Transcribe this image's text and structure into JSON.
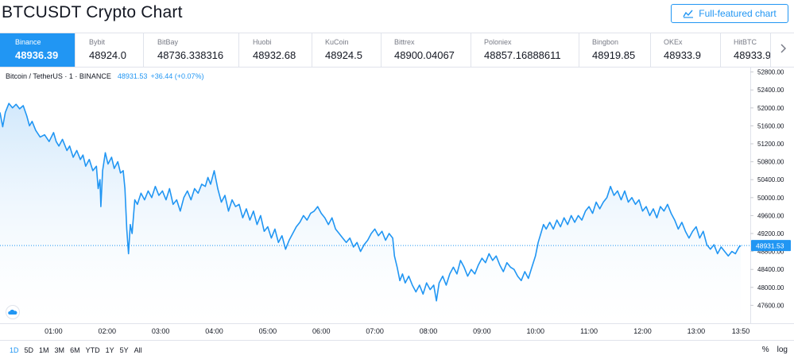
{
  "header": {
    "title": "BTCUSDT Crypto Chart",
    "full_chart_label": "Full-featured chart"
  },
  "exchanges": [
    {
      "name": "Binance",
      "price": "48936.39",
      "active": true
    },
    {
      "name": "Bybit",
      "price": "48924.0"
    },
    {
      "name": "BitBay",
      "price": "48736.338316"
    },
    {
      "name": "Huobi",
      "price": "48932.68"
    },
    {
      "name": "KuCoin",
      "price": "48924.5"
    },
    {
      "name": "Bittrex",
      "price": "48900.04067"
    },
    {
      "name": "Poloniex",
      "price": "48857.16888611"
    },
    {
      "name": "Bingbon",
      "price": "48919.85"
    },
    {
      "name": "OKEx",
      "price": "48933.9"
    },
    {
      "name": "HitBTC",
      "price": "48933.9"
    }
  ],
  "legend": {
    "symbol": "Bitcoin / TetherUS · 1 · BINANCE",
    "last": "48931.53",
    "change": "+36.44 (+0.07%)"
  },
  "ranges": {
    "items": [
      "1D",
      "5D",
      "1M",
      "3M",
      "6M",
      "YTD",
      "1Y",
      "5Y",
      "All"
    ],
    "active": "1D",
    "percent_label": "%",
    "log_label": "log"
  },
  "colors": {
    "line": "#2196f3",
    "area_top": "#cde6fb",
    "area_bottom": "#ffffff",
    "active_tab": "#2196f3",
    "grid": "#f0f3fa"
  },
  "chart_data": {
    "type": "area",
    "title": "",
    "xlabel": "",
    "ylabel": "",
    "x_ticks": [
      "01:00",
      "02:00",
      "03:00",
      "04:00",
      "05:00",
      "06:00",
      "07:00",
      "08:00",
      "09:00",
      "10:00",
      "11:00",
      "12:00",
      "13:00",
      "13:50"
    ],
    "y_ticks": [
      47600,
      48000,
      48400,
      48800,
      49200,
      49600,
      50000,
      50400,
      50800,
      51200,
      51600,
      52000,
      52400,
      52800
    ],
    "ylim": [
      47200,
      52900
    ],
    "last_price": 48931.53,
    "series": [
      {
        "points": [
          [
            "00:00",
            51900
          ],
          [
            "00:03",
            51580
          ],
          [
            "00:06",
            51900
          ],
          [
            "00:10",
            52100
          ],
          [
            "00:14",
            52000
          ],
          [
            "00:18",
            52080
          ],
          [
            "00:22",
            51980
          ],
          [
            "00:26",
            52050
          ],
          [
            "00:30",
            51820
          ],
          [
            "00:33",
            51600
          ],
          [
            "00:36",
            51700
          ],
          [
            "00:40",
            51500
          ],
          [
            "00:45",
            51350
          ],
          [
            "00:50",
            51400
          ],
          [
            "00:55",
            51250
          ],
          [
            "01:00",
            51450
          ],
          [
            "01:03",
            51250
          ],
          [
            "01:06",
            51150
          ],
          [
            "01:10",
            51300
          ],
          [
            "01:15",
            51050
          ],
          [
            "01:18",
            51150
          ],
          [
            "01:22",
            50900
          ],
          [
            "01:26",
            51050
          ],
          [
            "01:30",
            50850
          ],
          [
            "01:33",
            50950
          ],
          [
            "01:36",
            50700
          ],
          [
            "01:40",
            50850
          ],
          [
            "01:44",
            50600
          ],
          [
            "01:48",
            50700
          ],
          [
            "01:50",
            50200
          ],
          [
            "01:52",
            50400
          ],
          [
            "01:53",
            49800
          ],
          [
            "01:55",
            50600
          ],
          [
            "01:58",
            51000
          ],
          [
            "02:01",
            50750
          ],
          [
            "02:05",
            50900
          ],
          [
            "02:08",
            50650
          ],
          [
            "02:12",
            50800
          ],
          [
            "02:15",
            50550
          ],
          [
            "02:18",
            50600
          ],
          [
            "02:20",
            50200
          ],
          [
            "02:22",
            49300
          ],
          [
            "02:24",
            48750
          ],
          [
            "02:26",
            49400
          ],
          [
            "02:28",
            49200
          ],
          [
            "02:31",
            49950
          ],
          [
            "02:34",
            49850
          ],
          [
            "02:38",
            50100
          ],
          [
            "02:42",
            49950
          ],
          [
            "02:46",
            50150
          ],
          [
            "02:50",
            50000
          ],
          [
            "02:54",
            50250
          ],
          [
            "02:58",
            50050
          ],
          [
            "03:02",
            50150
          ],
          [
            "03:06",
            49950
          ],
          [
            "03:10",
            50200
          ],
          [
            "03:14",
            49850
          ],
          [
            "03:18",
            49950
          ],
          [
            "03:22",
            49700
          ],
          [
            "03:26",
            50000
          ],
          [
            "03:30",
            50150
          ],
          [
            "03:34",
            49950
          ],
          [
            "03:38",
            50200
          ],
          [
            "03:42",
            50100
          ],
          [
            "03:46",
            50300
          ],
          [
            "03:50",
            50250
          ],
          [
            "03:53",
            50450
          ],
          [
            "03:56",
            50300
          ],
          [
            "04:00",
            50600
          ],
          [
            "04:04",
            50200
          ],
          [
            "04:08",
            49900
          ],
          [
            "04:12",
            50050
          ],
          [
            "04:16",
            49700
          ],
          [
            "04:20",
            49950
          ],
          [
            "04:24",
            49800
          ],
          [
            "04:28",
            49850
          ],
          [
            "04:32",
            49550
          ],
          [
            "04:36",
            49750
          ],
          [
            "04:40",
            49500
          ],
          [
            "04:44",
            49700
          ],
          [
            "04:48",
            49400
          ],
          [
            "04:52",
            49600
          ],
          [
            "04:56",
            49250
          ],
          [
            "05:00",
            49350
          ],
          [
            "05:04",
            49100
          ],
          [
            "05:08",
            49300
          ],
          [
            "05:12",
            49000
          ],
          [
            "05:16",
            49150
          ],
          [
            "05:20",
            48850
          ],
          [
            "05:24",
            49050
          ],
          [
            "05:28",
            49200
          ],
          [
            "05:32",
            49350
          ],
          [
            "05:36",
            49450
          ],
          [
            "05:40",
            49600
          ],
          [
            "05:44",
            49500
          ],
          [
            "05:48",
            49650
          ],
          [
            "05:52",
            49700
          ],
          [
            "05:56",
            49800
          ],
          [
            "06:00",
            49650
          ],
          [
            "06:04",
            49550
          ],
          [
            "06:08",
            49400
          ],
          [
            "06:12",
            49550
          ],
          [
            "06:16",
            49300
          ],
          [
            "06:20",
            49200
          ],
          [
            "06:24",
            49100
          ],
          [
            "06:28",
            49000
          ],
          [
            "06:32",
            49100
          ],
          [
            "06:36",
            48900
          ],
          [
            "06:40",
            49000
          ],
          [
            "06:44",
            48800
          ],
          [
            "06:48",
            48950
          ],
          [
            "06:52",
            49050
          ],
          [
            "06:56",
            49200
          ],
          [
            "07:00",
            49300
          ],
          [
            "07:04",
            49150
          ],
          [
            "07:08",
            49250
          ],
          [
            "07:12",
            49050
          ],
          [
            "07:16",
            49200
          ],
          [
            "07:20",
            49100
          ],
          [
            "07:22",
            48700
          ],
          [
            "07:25",
            48450
          ],
          [
            "07:28",
            48150
          ],
          [
            "07:31",
            48300
          ],
          [
            "07:34",
            48100
          ],
          [
            "07:38",
            48250
          ],
          [
            "07:42",
            48050
          ],
          [
            "07:46",
            47900
          ],
          [
            "07:50",
            48050
          ],
          [
            "07:54",
            47850
          ],
          [
            "07:58",
            48100
          ],
          [
            "08:02",
            47950
          ],
          [
            "08:06",
            48050
          ],
          [
            "08:09",
            47700
          ],
          [
            "08:12",
            48100
          ],
          [
            "08:16",
            48250
          ],
          [
            "08:20",
            48050
          ],
          [
            "08:24",
            48300
          ],
          [
            "08:28",
            48450
          ],
          [
            "08:32",
            48300
          ],
          [
            "08:36",
            48600
          ],
          [
            "08:40",
            48450
          ],
          [
            "08:44",
            48250
          ],
          [
            "08:48",
            48400
          ],
          [
            "08:52",
            48300
          ],
          [
            "08:56",
            48500
          ],
          [
            "09:00",
            48650
          ],
          [
            "09:04",
            48550
          ],
          [
            "09:08",
            48750
          ],
          [
            "09:12",
            48600
          ],
          [
            "09:16",
            48700
          ],
          [
            "09:20",
            48500
          ],
          [
            "09:24",
            48350
          ],
          [
            "09:28",
            48550
          ],
          [
            "09:32",
            48450
          ],
          [
            "09:36",
            48400
          ],
          [
            "09:40",
            48250
          ],
          [
            "09:44",
            48150
          ],
          [
            "09:48",
            48350
          ],
          [
            "09:52",
            48200
          ],
          [
            "09:56",
            48450
          ],
          [
            "10:00",
            48700
          ],
          [
            "10:03",
            49000
          ],
          [
            "10:06",
            49200
          ],
          [
            "10:09",
            49400
          ],
          [
            "10:12",
            49300
          ],
          [
            "10:16",
            49450
          ],
          [
            "10:20",
            49300
          ],
          [
            "10:24",
            49500
          ],
          [
            "10:28",
            49350
          ],
          [
            "10:32",
            49550
          ],
          [
            "10:36",
            49400
          ],
          [
            "10:40",
            49600
          ],
          [
            "10:44",
            49450
          ],
          [
            "10:48",
            49600
          ],
          [
            "10:52",
            49500
          ],
          [
            "10:56",
            49700
          ],
          [
            "11:00",
            49800
          ],
          [
            "11:04",
            49650
          ],
          [
            "11:08",
            49900
          ],
          [
            "11:12",
            49750
          ],
          [
            "11:16",
            49900
          ],
          [
            "11:20",
            50000
          ],
          [
            "11:24",
            50250
          ],
          [
            "11:28",
            50050
          ],
          [
            "11:32",
            50150
          ],
          [
            "11:36",
            49950
          ],
          [
            "11:40",
            50150
          ],
          [
            "11:44",
            49900
          ],
          [
            "11:48",
            50000
          ],
          [
            "11:52",
            49850
          ],
          [
            "11:56",
            49950
          ],
          [
            "12:00",
            49700
          ],
          [
            "12:04",
            49800
          ],
          [
            "12:08",
            49600
          ],
          [
            "12:12",
            49750
          ],
          [
            "12:16",
            49550
          ],
          [
            "12:20",
            49800
          ],
          [
            "12:24",
            49700
          ],
          [
            "12:28",
            49850
          ],
          [
            "12:32",
            49650
          ],
          [
            "12:36",
            49500
          ],
          [
            "12:40",
            49300
          ],
          [
            "12:44",
            49450
          ],
          [
            "12:48",
            49250
          ],
          [
            "12:52",
            49100
          ],
          [
            "12:56",
            49250
          ],
          [
            "13:00",
            49350
          ],
          [
            "13:04",
            49100
          ],
          [
            "13:08",
            49250
          ],
          [
            "13:12",
            48950
          ],
          [
            "13:16",
            48850
          ],
          [
            "13:20",
            48950
          ],
          [
            "13:24",
            48750
          ],
          [
            "13:28",
            48900
          ],
          [
            "13:32",
            48800
          ],
          [
            "13:36",
            48700
          ],
          [
            "13:40",
            48800
          ],
          [
            "13:44",
            48750
          ],
          [
            "13:48",
            48900
          ],
          [
            "13:50",
            48931.53
          ]
        ]
      }
    ]
  }
}
